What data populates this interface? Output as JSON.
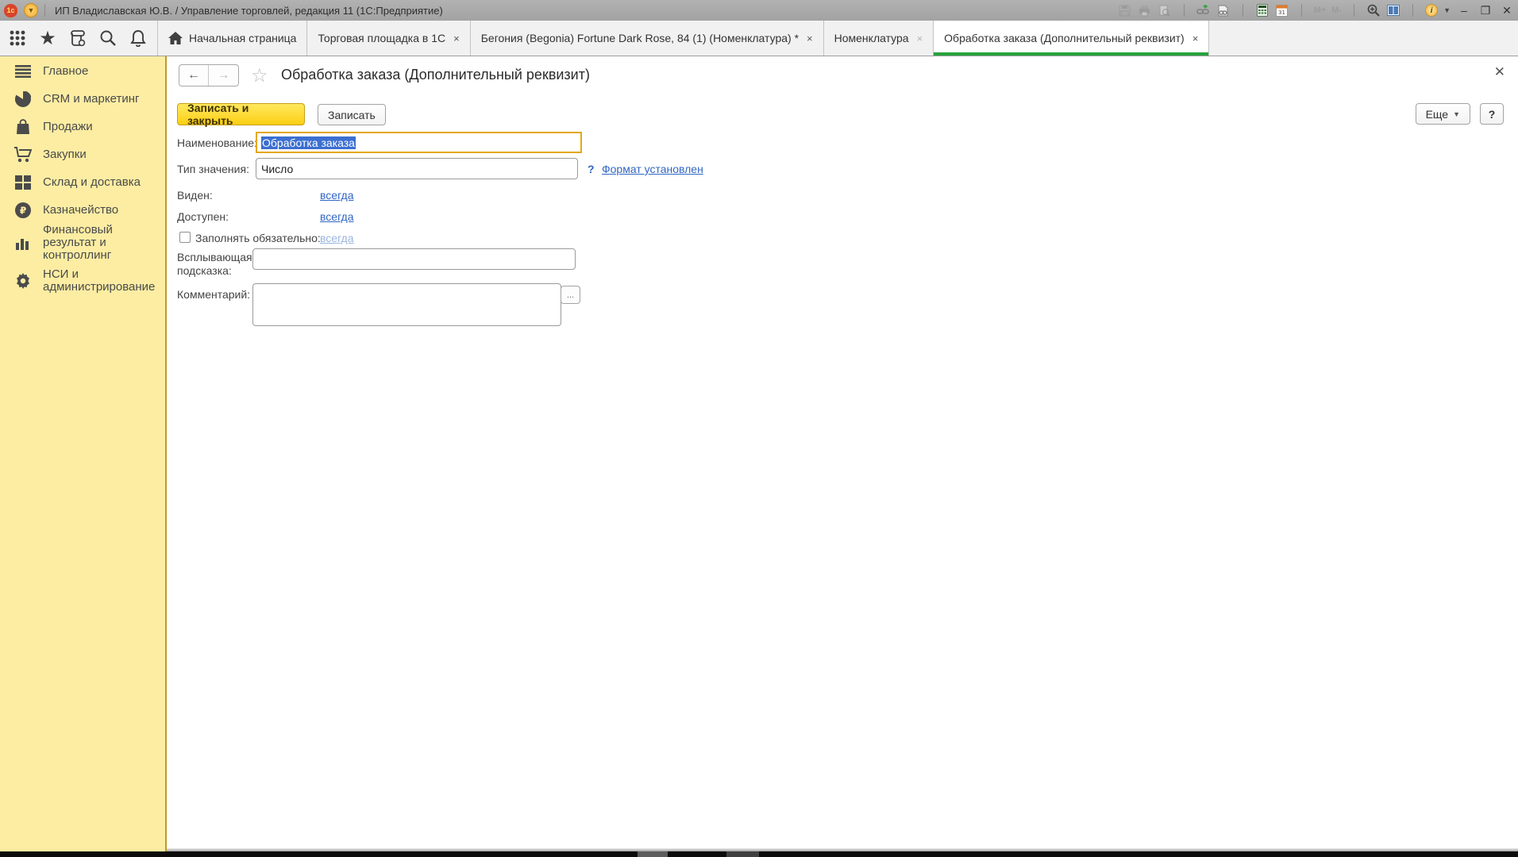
{
  "window": {
    "title": "ИП Владиславская Ю.В. / Управление торговлей, редакция 11  (1С:Предприятие)",
    "logo_text": "1с",
    "memory_plus": "M+",
    "memory_minus": "M-",
    "calendar_day": "31",
    "info_glyph": "i",
    "minimize_glyph": "–",
    "restore_glyph": "❐",
    "close_glyph": "✕",
    "titlebar_icons": [
      "save-icon",
      "print-icon",
      "print-preview-icon",
      "go-to-link-icon",
      "get-link-icon",
      "calculator-icon",
      "calendar-icon",
      "zoom-in-icon",
      "split-columns-icon",
      "info-icon"
    ]
  },
  "quickbar_icons": [
    "apps-grid-icon",
    "favorites-star-icon",
    "history-icon",
    "search-icon",
    "notifications-bell-icon"
  ],
  "tabs": [
    {
      "label": "Начальная страница",
      "icon": "home-icon",
      "close": ""
    },
    {
      "label": "Торговая площадка в 1С",
      "close": "×"
    },
    {
      "label": "Бегония (Begonia) Fortune Dark Rose, 84 (1) (Номенклатура) *",
      "close": "×"
    },
    {
      "label": "Номенклатура",
      "close": "×"
    },
    {
      "label": "Обработка заказа (Дополнительный реквизит)",
      "close": "×"
    }
  ],
  "sidebar": {
    "items": [
      {
        "label": "Главное",
        "icon": "menu-icon"
      },
      {
        "label": "CRM и маркетинг",
        "icon": "pie-chart-icon"
      },
      {
        "label": "Продажи",
        "icon": "shopping-bag-icon"
      },
      {
        "label": "Закупки",
        "icon": "shopping-cart-icon"
      },
      {
        "label": "Склад и доставка",
        "icon": "warehouse-icon"
      },
      {
        "label": "Казначейство",
        "icon": "ruble-coin-icon"
      },
      {
        "label": "Финансовый результат и контроллинг",
        "icon": "bar-chart-icon"
      },
      {
        "label": "НСИ и администрирование",
        "icon": "gear-icon"
      }
    ]
  },
  "form": {
    "title": "Обработка заказа (Дополнительный реквизит)",
    "nav": {
      "back": "←",
      "forward": "→",
      "favorite": "☆",
      "close": "✕"
    },
    "buttons": {
      "save_close": "Записать и закрыть",
      "save": "Записать",
      "more": "Еще",
      "more_caret": "▼",
      "help": "?"
    },
    "fields": {
      "name": {
        "label": "Наименование:",
        "value": "Обработка заказа",
        "selected": true
      },
      "value_type": {
        "label": "Тип значения:",
        "value": "Число",
        "hint": "?",
        "format_link": "Формат установлен"
      },
      "visible": {
        "label": "Виден:",
        "link": "всегда"
      },
      "available": {
        "label": "Доступен:",
        "link": "всегда"
      },
      "required": {
        "label": "Заполнять обязательно:",
        "link": "всегда",
        "checked": false
      },
      "tooltip": {
        "label": "Всплывающая подсказка:",
        "value": ""
      },
      "comment": {
        "label": "Комментарий:",
        "value": "",
        "ellipsis": "..."
      }
    }
  },
  "colors": {
    "active_tab_underline": "#27a23d",
    "sidebar_bg": "#fceda3",
    "sidebar_border": "#bf9b26",
    "primary_button": "#fdd629",
    "focus_border": "#e5a812",
    "selection_bg": "#3b6fd1",
    "link": "#3166c4",
    "link_disabled": "#9ab4de",
    "titlebar_bg": "#a8a8a8"
  }
}
